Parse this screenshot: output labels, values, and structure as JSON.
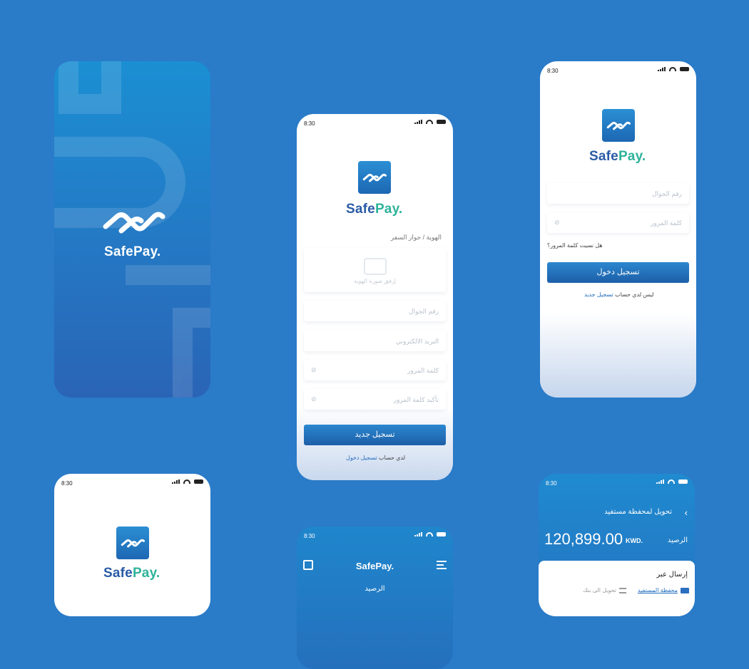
{
  "time": "8:30",
  "brand": {
    "part1": "Safe",
    "part2": "Pay."
  },
  "register": {
    "id_label": "الهوية / جواز السفر",
    "attach_photo": "إرفق صورة الهوية",
    "phone_placeholder": "رقم الجوال",
    "email_placeholder": "البريد الالكتروني",
    "password_placeholder": "كلمة المرور",
    "confirm_password_placeholder": "تأكيد كلمة المرور",
    "submit": "تسجيل جديد",
    "have_account": "لدي حساب",
    "login_link": "تسجيل دخول"
  },
  "login": {
    "phone_placeholder": "رقم الجوال",
    "password_placeholder": "كلمة المرور",
    "forgot": "هل نسيت كلمة المرور؟",
    "submit": "تسجيل دخول",
    "no_account": "ليس لدي حساب",
    "register_link": "تسجيل جديد"
  },
  "home": {
    "title": "SafePay.",
    "balance_label": "الرصيد"
  },
  "transfer": {
    "title": "تحويل لمحفظة مستفيد",
    "balance_label": "الرصيد",
    "balance_value": "120,899.00",
    "currency": "KWD.",
    "send_via": "إرسال عبر",
    "option_wallet": "محفظة المستفيد",
    "option_bank": "تحويل الى بنك"
  },
  "colors": {
    "background": "#2a7bc8",
    "accent": "#1f6bbd",
    "brand_green": "#2db39a"
  }
}
